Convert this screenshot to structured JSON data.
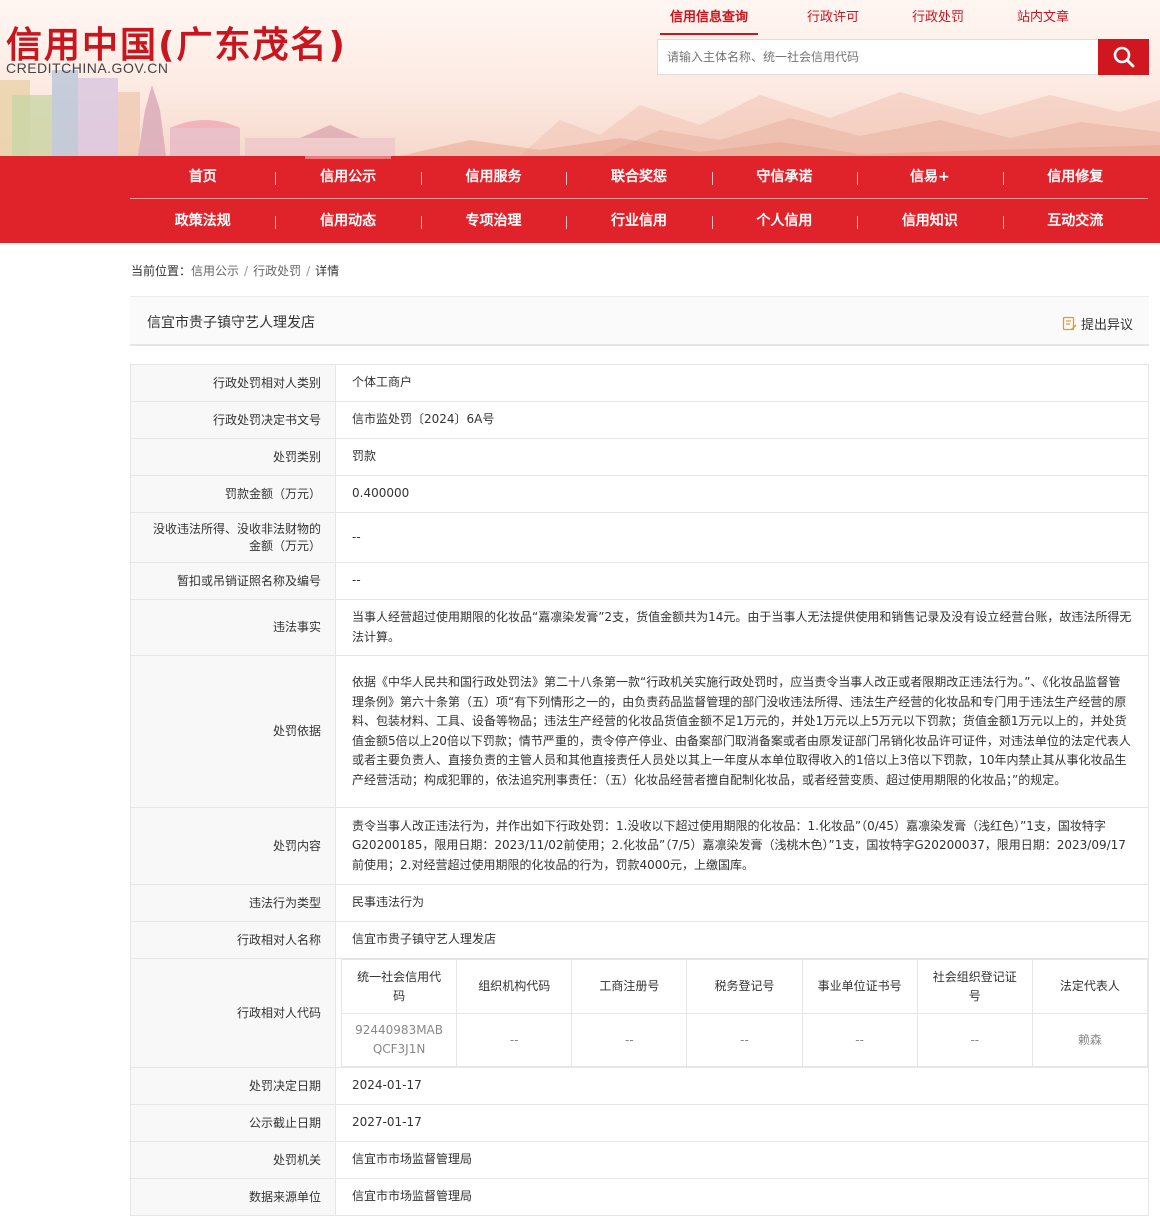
{
  "header": {
    "logo_main": "信用中国(广东茂名)",
    "logo_sub": "CREDITCHINA.GOV.CN",
    "top_links": [
      "信用信息查询",
      "行政许可",
      "行政处罚",
      "站内文章"
    ],
    "search_placeholder": "请输入主体名称、统一社会信用代码",
    "colors": {
      "brand": "#c9151e",
      "nav_bg": "#e0232a"
    }
  },
  "nav": {
    "row1": [
      "首页",
      "信用公示",
      "信用服务",
      "联合奖惩",
      "守信承诺",
      "信易+",
      "信用修复"
    ],
    "row2": [
      "政策法规",
      "信用动态",
      "专项治理",
      "行业信用",
      "个人信用",
      "信用知识",
      "互动交流"
    ]
  },
  "breadcrumb": {
    "label": "当前位置：",
    "items": [
      "信用公示",
      "行政处罚",
      "详情"
    ],
    "sep": "/"
  },
  "title_bar": {
    "name": "信宜市贵子镇守艺人理发店",
    "objection": "提出异议"
  },
  "rows": [
    {
      "label": "行政处罚相对人类别",
      "value": "个体工商户"
    },
    {
      "label": "行政处罚决定书文号",
      "value": "信市监处罚〔2024〕6A号"
    },
    {
      "label": "处罚类别",
      "value": "罚款"
    },
    {
      "label": "罚款金额（万元）",
      "value": "0.400000"
    },
    {
      "label": "没收违法所得、没收非法财物的金额（万元）",
      "value": "--"
    },
    {
      "label": "暂扣或吊销证照名称及编号",
      "value": "--"
    },
    {
      "label": "违法事实",
      "value": "当事人经营超过使用期限的化妆品“嘉凛染发膏”2支，货值金额共为14元。由于当事人无法提供使用和销售记录及没有设立经营台账，故违法所得无法计算。"
    },
    {
      "label": "处罚依据",
      "value": "依据《中华人民共和国行政处罚法》第二十八条第一款“行政机关实施行政处罚时，应当责令当事人改正或者限期改正违法行为。”、《化妆品监督管理条例》第六十条第（五）项“有下列情形之一的，由负责药品监督管理的部门没收违法所得、违法生产经营的化妆品和专门用于违法生产经营的原料、包装材料、工具、设备等物品；违法生产经营的化妆品货值金额不足1万元的，并处1万元以上5万元以下罚款；货值金额1万元以上的，并处货值金额5倍以上20倍以下罚款；情节严重的，责令停产停业、由备案部门取消备案或者由原发证部门吊销化妆品许可证件，对违法单位的法定代表人或者主要负责人、直接负责的主管人员和其他直接责任人员处以其上一年度从本单位取得收入的1倍以上3倍以下罚款，10年内禁止其从事化妆品生产经营活动；构成犯罪的，依法追究刑事责任：（五）化妆品经营者擅自配制化妆品，或者经营变质、超过使用期限的化妆品；”的规定。"
    },
    {
      "label": "处罚内容",
      "value": "责令当事人改正违法行为，并作出如下行政处罚：1.没收以下超过使用期限的化妆品：1.化妆品”（0/45）嘉凛染发膏（浅红色）”1支，国妆特字G20200185，限用日期：2023/11/02前使用；2.化妆品”（7/5）嘉凛染发膏（浅桃木色）”1支，国妆特字G20200037，限用日期：2023/09/17前使用；2.对经营超过使用期限的化妆品的行为，罚款4000元，上缴国库。"
    },
    {
      "label": "违法行为类型",
      "value": "民事违法行为"
    },
    {
      "label": "行政相对人名称",
      "value": "信宜市贵子镇守艺人理发店"
    }
  ],
  "codes": {
    "label": "行政相对人代码",
    "headers": [
      "统一社会信用代码",
      "组织机构代码",
      "工商注册号",
      "税务登记号",
      "事业单位证书号",
      "社会组织登记证号",
      "法定代表人"
    ],
    "values": [
      "92440983MABQCF3J1N",
      "--",
      "--",
      "--",
      "--",
      "--",
      "赖森"
    ]
  },
  "rows_after": [
    {
      "label": "处罚决定日期",
      "value": "2024-01-17"
    },
    {
      "label": "公示截止日期",
      "value": "2027-01-17"
    },
    {
      "label": "处罚机关",
      "value": "信宜市市场监督管理局"
    },
    {
      "label": "数据来源单位",
      "value": "信宜市市场监督管理局"
    }
  ]
}
